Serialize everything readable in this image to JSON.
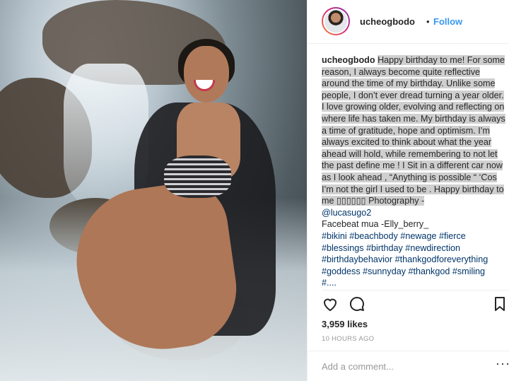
{
  "post": {
    "username": "ucheogbodo",
    "dot": "•",
    "follow_label": "Follow",
    "caption": {
      "username": "ucheogbodo",
      "text": "Happy birthday to me! For some reason, I always become quite reflective around the time of my birthday. Unlike some people, I don’t ever dread turning a year older. I love growing older, evolving and reflecting on where life has taken me. My birthday is always a time of gratitude, hope and optimism. I’m always excited to think about what the year ahead will hold, while remembering to not let the past define me ! I Sit in a different car now as I look ahead , “Anything is possible “ ‘Cos I’m not the girl I used to be . Happy birthday to me ▯▯▯▯▯▯",
      "photography_label": " Photography -",
      "photographer": "@lucasugo2",
      "makeup": "Facebeat mua -Elly_berry_",
      "hashtag_lines": [
        "#bikini #beachbody #newage #fierce",
        "#blessings #birthday #newdirection",
        "#birthdaybehavior #thankgodforeverything",
        "#goddess #sunnyday #thankgod #smiling",
        "#...."
      ]
    },
    "likes": "3,959 likes",
    "time": "10 HOURS AGO",
    "comment_placeholder": "Add a comment...",
    "more_label": "···"
  },
  "icons": [
    "heart-icon",
    "comment-icon",
    "bookmark-icon"
  ],
  "colors": {
    "link": "#3897f0",
    "hashtag": "#003569",
    "highlight": "#cfcfcf"
  }
}
